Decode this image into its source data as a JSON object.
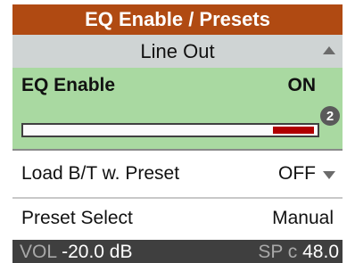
{
  "header": {
    "title": "EQ Enable / Presets"
  },
  "section": {
    "title": "Line Out"
  },
  "eq_enable": {
    "label": "EQ Enable",
    "value": "ON",
    "badge": "2",
    "level_fraction": 0.14
  },
  "load_bt": {
    "label": "Load B/T w. Preset",
    "value": "OFF"
  },
  "preset_select": {
    "label": "Preset Select",
    "value": "Manual"
  },
  "status": {
    "vol_label": "VOL",
    "vol_value": "-20.0 dB",
    "sp_label": "SP c",
    "sp_value": "48.0"
  },
  "colors": {
    "header": "#b04a12",
    "section": "#cfd4d4",
    "selected": "#a9d9a1",
    "bar_fill": "#b00000",
    "status": "#3f3f3f"
  },
  "icons": {
    "section_arrow": "triangle-up-icon",
    "row_arrow": "triangle-down-icon",
    "badge": "number-badge-icon"
  }
}
